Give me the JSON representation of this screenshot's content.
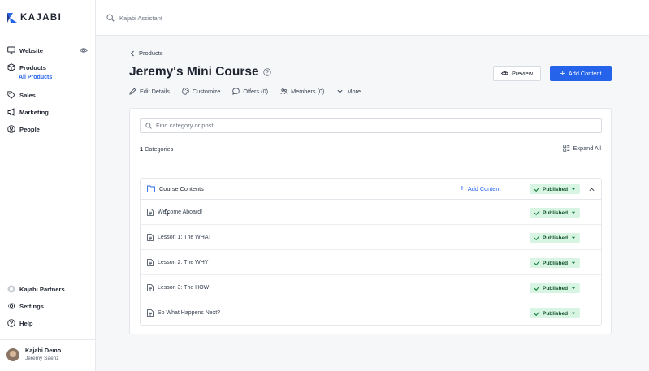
{
  "brand": {
    "name": "KAJABI",
    "accent": "#2563eb"
  },
  "sidebar": {
    "items": [
      {
        "label": "Website",
        "icon": "monitor-icon"
      },
      {
        "label": "Products",
        "icon": "cube-icon",
        "sub": "All Products"
      },
      {
        "label": "Sales",
        "icon": "tag-icon"
      },
      {
        "label": "Marketing",
        "icon": "megaphone-icon"
      },
      {
        "label": "People",
        "icon": "person-circle-icon"
      }
    ],
    "bottom": [
      {
        "label": "Kajabi Partners",
        "icon": "partners-icon"
      },
      {
        "label": "Settings",
        "icon": "gear-icon"
      },
      {
        "label": "Help",
        "icon": "help-icon"
      }
    ],
    "user": {
      "name": "Kajabi Demo",
      "sub": "Jeremy Saenz"
    }
  },
  "topbar": {
    "assistant_placeholder": "Kajabi Assistant"
  },
  "header": {
    "back_label": "Products",
    "title": "Jeremy's Mini Course",
    "preview_label": "Preview",
    "add_label": "Add Content"
  },
  "tabs": [
    {
      "label": "Edit Details",
      "icon": "pencil-icon"
    },
    {
      "label": "Customize",
      "icon": "palette-icon"
    },
    {
      "label": "Offers (0)",
      "icon": "chat-icon"
    },
    {
      "label": "Members (0)",
      "icon": "members-icon"
    },
    {
      "label": "More",
      "icon": "chevron-down-icon"
    }
  ],
  "content": {
    "search_placeholder": "Find category or post...",
    "count_number": "1",
    "count_label": " Categories",
    "expand_label": "Expand All",
    "category": {
      "title": "Course Contents",
      "add_label": "Add Content",
      "status": "Published",
      "posts": [
        {
          "title": "Welcome Aboard!",
          "status": "Published"
        },
        {
          "title": "Lesson 1: The WHAT",
          "status": "Published"
        },
        {
          "title": "Lesson 2: The WHY",
          "status": "Published"
        },
        {
          "title": "Lesson 3: The HOW",
          "status": "Published"
        },
        {
          "title": "So What Happens Next?",
          "status": "Published"
        }
      ]
    }
  }
}
